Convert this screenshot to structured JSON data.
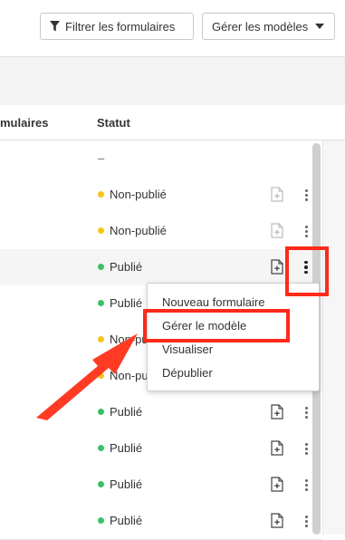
{
  "toolbar": {
    "filter_label": "Filtrer les formulaires",
    "models_label": "Gérer les modèles"
  },
  "table": {
    "col_forms_header": "mulaires",
    "col_status_header": "Statut",
    "rows": [
      {
        "status": "–",
        "has_actions": false
      },
      {
        "status": "Non-publié",
        "dot_color": "#f5c518",
        "icon_state": "disabled"
      },
      {
        "status": "Non-publié",
        "dot_color": "#f5c518",
        "icon_state": "disabled"
      },
      {
        "status": "Publié",
        "dot_color": "#3cbf6b",
        "icon_state": "enabled"
      },
      {
        "status": "Publié",
        "dot_color": "#3cbf6b",
        "icon_state": "enabled"
      },
      {
        "status": "Non-publié",
        "dot_color": "#f5c518",
        "icon_state": "enabled"
      },
      {
        "status": "Non-publié",
        "dot_color": "#f5c518",
        "icon_state": "enabled"
      },
      {
        "status": "Publié",
        "dot_color": "#3cbf6b",
        "icon_state": "enabled"
      },
      {
        "status": "Publié",
        "dot_color": "#3cbf6b",
        "icon_state": "enabled"
      },
      {
        "status": "Publié",
        "dot_color": "#3cbf6b",
        "icon_state": "enabled"
      },
      {
        "status": "Publié",
        "dot_color": "#3cbf6b",
        "icon_state": "enabled"
      }
    ]
  },
  "dropdown_menu": {
    "items": [
      "Nouveau formulaire",
      "Gérer le modèle",
      "Visualiser",
      "Dépublier"
    ]
  },
  "annotation": {
    "highlight_color": "#ff2a1a"
  },
  "icons": {
    "filter": "filter-icon",
    "caret": "caret-down-icon",
    "document": "document-plus-icon",
    "kebab": "kebab-menu-icon"
  }
}
